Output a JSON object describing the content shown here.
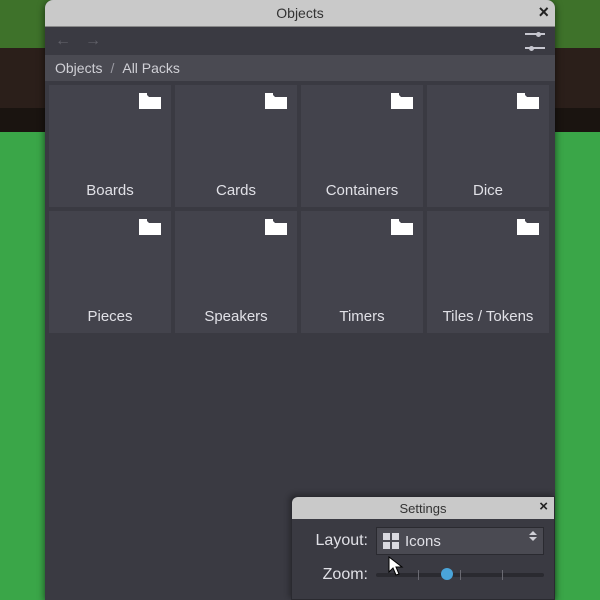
{
  "window": {
    "title": "Objects",
    "close_glyph": "×"
  },
  "nav": {
    "back_glyph": "←",
    "forward_glyph": "→"
  },
  "breadcrumb": {
    "items": [
      "Objects",
      "All Packs"
    ],
    "sep": "/"
  },
  "grid": {
    "items": [
      {
        "label": "Boards"
      },
      {
        "label": "Cards"
      },
      {
        "label": "Containers"
      },
      {
        "label": "Dice"
      },
      {
        "label": "Pieces"
      },
      {
        "label": "Speakers"
      },
      {
        "label": "Timers"
      },
      {
        "label": "Tiles / Tokens"
      }
    ]
  },
  "settings": {
    "title": "Settings",
    "close_glyph": "×",
    "layout_label": "Layout:",
    "layout_value": "Icons",
    "zoom_label": "Zoom:",
    "zoom_value_pct": 42
  }
}
